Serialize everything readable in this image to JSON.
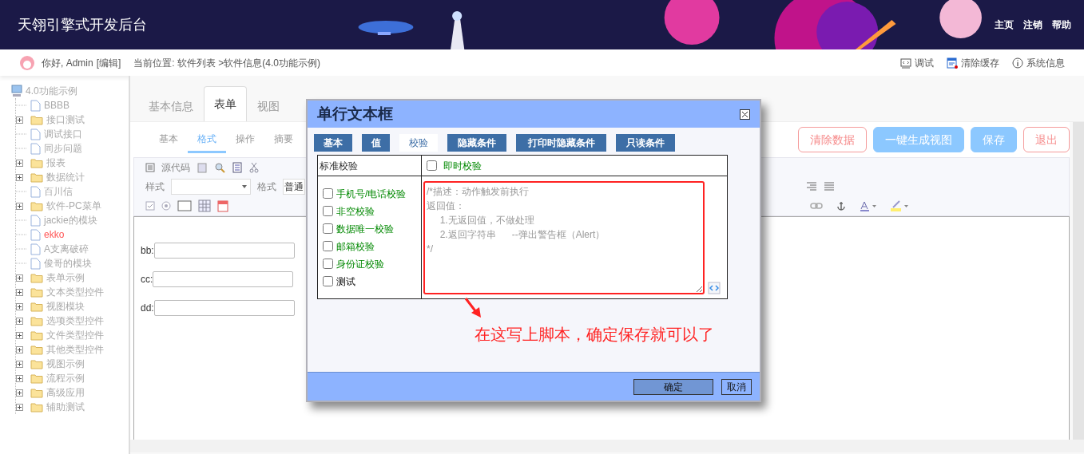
{
  "header": {
    "title": "天翎引擎式开发后台",
    "links": [
      "主页",
      "注销",
      "帮助"
    ]
  },
  "userbar": {
    "greeting": "你好, Admin",
    "edit": "[编辑]",
    "breadcrumb": "当前位置: 软件列表 >软件信息(4.0功能示例)",
    "tools": [
      {
        "label": "调试",
        "kind": "debug"
      },
      {
        "label": "清除缓存",
        "kind": "cache"
      },
      {
        "label": "系统信息",
        "kind": "info"
      }
    ]
  },
  "tree": {
    "root": "4.0功能示例",
    "children": [
      {
        "label": "BBBB",
        "kind": "file",
        "selected": false
      },
      {
        "label": "接口测试",
        "kind": "folder",
        "selected": false
      },
      {
        "label": "调试接口",
        "kind": "file",
        "selected": false
      },
      {
        "label": "同步问题",
        "kind": "file",
        "selected": false
      },
      {
        "label": "报表",
        "kind": "folder",
        "selected": false
      },
      {
        "label": "数据统计",
        "kind": "folder",
        "selected": false
      },
      {
        "label": "百川信",
        "kind": "file",
        "selected": false
      },
      {
        "label": "软件-PC菜单",
        "kind": "folder",
        "selected": false
      },
      {
        "label": "jackie的模块",
        "kind": "file",
        "selected": false
      },
      {
        "label": "ekko",
        "kind": "file",
        "selected": true
      },
      {
        "label": "A支离破碎",
        "kind": "file",
        "selected": false
      },
      {
        "label": "俊哥的模块",
        "kind": "file",
        "selected": false
      },
      {
        "label": "表单示例",
        "kind": "folder",
        "selected": false
      },
      {
        "label": "文本类型控件",
        "kind": "folder",
        "selected": false
      },
      {
        "label": "视图模块",
        "kind": "folder",
        "selected": false
      },
      {
        "label": "选项类型控件",
        "kind": "folder",
        "selected": false
      },
      {
        "label": "文件类型控件",
        "kind": "folder",
        "selected": false
      },
      {
        "label": "其他类型控件",
        "kind": "folder",
        "selected": false
      },
      {
        "label": "视图示例",
        "kind": "folder",
        "selected": false
      },
      {
        "label": "流程示例",
        "kind": "folder",
        "selected": false
      },
      {
        "label": "高级应用",
        "kind": "folder",
        "selected": false
      },
      {
        "label": "辅助测试",
        "kind": "folder",
        "selected": false
      }
    ]
  },
  "main_tabs": [
    {
      "label": "基本信息",
      "selected": false
    },
    {
      "label": "表单",
      "selected": true
    },
    {
      "label": "视图",
      "selected": false
    }
  ],
  "sub_tabs": [
    {
      "label": "基本",
      "selected": false
    },
    {
      "label": "格式",
      "selected": true
    },
    {
      "label": "操作",
      "selected": false
    },
    {
      "label": "摘要",
      "selected": false
    }
  ],
  "actions": [
    {
      "label": "清除数据",
      "kind": "outline"
    },
    {
      "label": "一键生成视图",
      "kind": "filled"
    },
    {
      "label": "保存",
      "kind": "filled"
    },
    {
      "label": "退出",
      "kind": "outline"
    }
  ],
  "editor": {
    "source_label": "源代码",
    "style_label": "样式",
    "format_label": "格式",
    "format_value": "普通"
  },
  "form_fields": [
    {
      "label": "bb:"
    },
    {
      "label": "cc:"
    },
    {
      "label": "dd:"
    }
  ],
  "dialog": {
    "title": "单行文本框",
    "tabs": [
      {
        "label": "基本",
        "selected": false
      },
      {
        "label": "值",
        "selected": false
      },
      {
        "label": "校验",
        "selected": true
      },
      {
        "label": "隐藏条件",
        "selected": false
      },
      {
        "label": "打印时隐藏条件",
        "selected": false
      },
      {
        "label": "只读条件",
        "selected": false
      }
    ],
    "standard_label": "标准校验",
    "instant": {
      "label": "即时校验",
      "checked": false
    },
    "validators": [
      {
        "label": "手机号/电话校验",
        "checked": false,
        "kind": "preset"
      },
      {
        "label": "非空校验",
        "checked": false,
        "kind": "preset"
      },
      {
        "label": "数据唯一校验",
        "checked": false,
        "kind": "preset"
      },
      {
        "label": "邮箱校验",
        "checked": false,
        "kind": "preset"
      },
      {
        "label": "身份证校验",
        "checked": false,
        "kind": "preset"
      },
      {
        "label": "测试",
        "checked": false,
        "kind": "custom"
      }
    ],
    "script_placeholder": [
      "/*描述：动作触发前执行",
      "返回值：",
      "1.无返回值，不做处理",
      "2.返回字符串      --弹出警告框（Alert）",
      "*/"
    ],
    "annotation": "在这写上脚本，确定保存就可以了",
    "buttons": [
      {
        "label": "确定",
        "kind": "primary"
      },
      {
        "label": "取消",
        "kind": "secondary"
      }
    ]
  }
}
